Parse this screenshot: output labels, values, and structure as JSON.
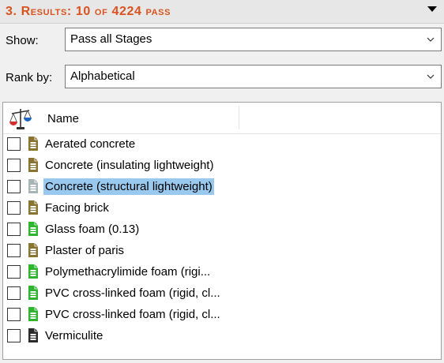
{
  "header": {
    "title": "3. Results: 10 of 4224 pass",
    "title_color": "#d9531e"
  },
  "show": {
    "label": "Show:",
    "value": "Pass all Stages"
  },
  "rank": {
    "label": "Rank by:",
    "value": "Alphabetical"
  },
  "list": {
    "column_header": "Name",
    "sort_icon": "scales-icon",
    "items": [
      {
        "label": "Aerated concrete",
        "icon": "datasheet-icon",
        "icon_color": "#8a7431",
        "checked": false,
        "selected": false
      },
      {
        "label": "Concrete (insulating lightweight)",
        "icon": "datasheet-icon",
        "icon_color": "#8a7431",
        "checked": false,
        "selected": false
      },
      {
        "label": "Concrete (structural lightweight)",
        "icon": "datasheet-icon",
        "icon_color": "#a7b6b4",
        "checked": false,
        "selected": true
      },
      {
        "label": "Facing brick",
        "icon": "datasheet-icon",
        "icon_color": "#8a7431",
        "checked": false,
        "selected": false
      },
      {
        "label": "Glass foam (0.13)",
        "icon": "datasheet-icon",
        "icon_color": "#2fb42f",
        "checked": false,
        "selected": false
      },
      {
        "label": "Plaster of paris",
        "icon": "datasheet-icon",
        "icon_color": "#8a7431",
        "checked": false,
        "selected": false
      },
      {
        "label": "Polymethacrylimide foam (rigi...",
        "icon": "datasheet-icon",
        "icon_color": "#2fb42f",
        "checked": false,
        "selected": false
      },
      {
        "label": "PVC cross-linked foam (rigid, cl...",
        "icon": "datasheet-icon",
        "icon_color": "#2fb42f",
        "checked": false,
        "selected": false
      },
      {
        "label": "PVC cross-linked foam (rigid, cl...",
        "icon": "datasheet-icon",
        "icon_color": "#2fb42f",
        "checked": false,
        "selected": false
      },
      {
        "label": "Vermiculite",
        "icon": "datasheet-icon",
        "icon_color": "#2b2b2b",
        "checked": false,
        "selected": false
      }
    ]
  },
  "colors": {
    "selection": "#99c9ef",
    "panel_bg": "#f0f0f0"
  }
}
